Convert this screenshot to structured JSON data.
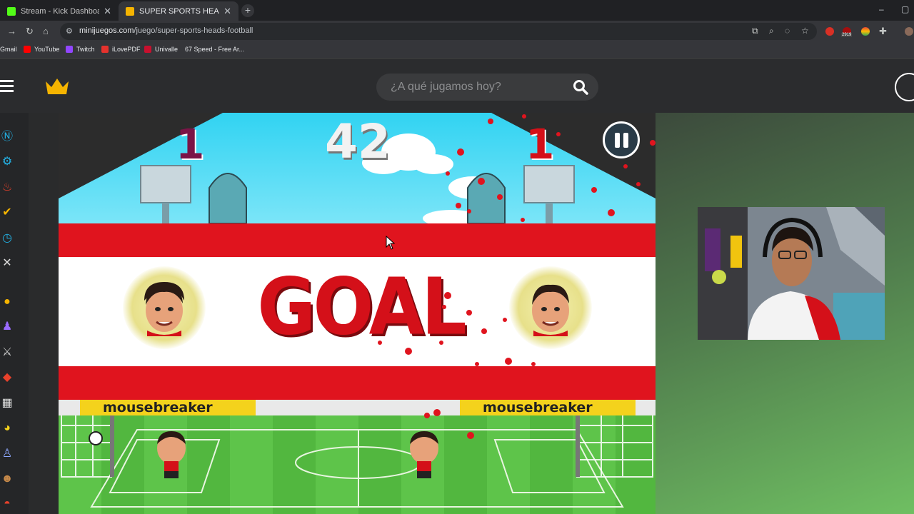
{
  "browser": {
    "tabs": [
      {
        "label": "Stream - Kick Dashboard",
        "favicon_color": "#53fc18"
      },
      {
        "label": "SUPER SPORTS HEADS FOOTBA",
        "favicon_color": "#f5b400"
      }
    ],
    "new_tab": "+",
    "url_host": "minijuegos.com",
    "url_path": "/juego/super-sports-heads-football",
    "extension_badge": "2919",
    "bookmarks": [
      "Gmail",
      "YouTube",
      "Twitch",
      "iLovePDF",
      "Univalle",
      "67 Speed - Free Ar..."
    ]
  },
  "site": {
    "search_placeholder": "¿A qué jugamos hoy?",
    "accent_color": "#f5b400"
  },
  "game": {
    "score_left": "1",
    "score_right": "1",
    "timer": "42",
    "goal_text": "GOAL",
    "ad_left": "mousebreaker",
    "ad_right": "mousebreaker",
    "colors": {
      "red": "#e0141e",
      "sky": "#31d3f2",
      "pitch": "#5ec44a",
      "score": "#7b1447"
    }
  }
}
